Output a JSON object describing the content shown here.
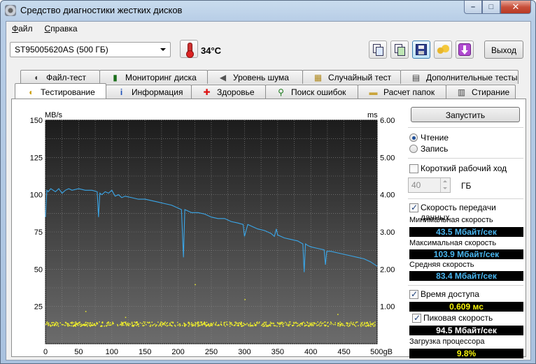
{
  "window": {
    "title": "Средство диагностики жестких дисков",
    "caption_minimize": "–",
    "caption_maximize": "□",
    "caption_close": "✕"
  },
  "menu": [
    {
      "accel": "Ф",
      "rest": "айл"
    },
    {
      "accel": "С",
      "rest": "правка"
    }
  ],
  "toolbar": {
    "drive": "ST95005620AS (500 ГБ)",
    "temperature": "34°C",
    "exit_label": "Выход"
  },
  "tabs_top": [
    "Файл-тест",
    "Мониторинг диска",
    "Уровень шума",
    "Случайный тест",
    "Дополнительные тесты"
  ],
  "tabs_bottom": [
    "Тестирование",
    "Информация",
    "Здоровье",
    "Поиск ошибок",
    "Расчет папок",
    "Стирание"
  ],
  "active_tab": "Тестирование",
  "chart_data": {
    "type": "line",
    "y_left_label": "MB/s",
    "y_right_label": "ms",
    "y_left_ticks": [
      "150",
      "125",
      "100",
      "75",
      "50",
      "25"
    ],
    "y_right_ticks": [
      "6.00",
      "5.00",
      "4.00",
      "3.00",
      "2.00",
      "1.00"
    ],
    "x_ticks": [
      "0",
      "50",
      "100",
      "150",
      "200",
      "250",
      "300",
      "350",
      "400",
      "450",
      "500gB"
    ],
    "x_range": [
      0,
      500
    ],
    "y_left_range": [
      0,
      150
    ],
    "y_right_range": [
      0,
      6
    ],
    "series": [
      {
        "color": "#3aa6e8",
        "x": [
          0,
          2,
          4,
          8,
          15,
          20,
          25,
          30,
          35,
          40,
          50,
          60,
          70,
          78,
          80,
          82,
          85,
          90,
          95,
          100,
          105,
          110,
          115,
          120,
          130,
          140,
          150,
          160,
          170,
          180,
          190,
          200,
          205,
          208,
          210,
          215,
          220,
          230,
          240,
          250,
          260,
          270,
          280,
          290,
          298,
          300,
          305,
          310,
          315,
          320,
          330,
          340,
          345,
          348,
          350,
          355,
          360,
          370,
          380,
          388,
          390,
          392,
          395,
          400,
          410,
          420,
          422,
          424,
          430,
          440,
          450,
          460,
          470,
          480,
          490,
          500
        ],
        "y": [
          85,
          103,
          102,
          104,
          102,
          104,
          101,
          103,
          104,
          103,
          104,
          103,
          103,
          102,
          85,
          101,
          100,
          102,
          101,
          103,
          99,
          100,
          98,
          99,
          98,
          97,
          97,
          96,
          95,
          94,
          93,
          91,
          90,
          58,
          90,
          89,
          88,
          88,
          87,
          85,
          84,
          84,
          82,
          81,
          80,
          72,
          80,
          79,
          78,
          77,
          76,
          74,
          72,
          77,
          73,
          72,
          71,
          70,
          69,
          67,
          48,
          67,
          66,
          65,
          64,
          63,
          53,
          62,
          62,
          61,
          60,
          59,
          58,
          57,
          55,
          52
        ]
      },
      {
        "color": "#f0ef2a",
        "kind": "scatter",
        "band": [
          12,
          15
        ]
      }
    ]
  },
  "side": {
    "run_label": "Запустить",
    "read_label": "Чтение",
    "write_label": "Запись",
    "short_stroke_label": "Короткий рабочий ход",
    "short_stroke_value": "40",
    "short_stroke_unit": "ГБ",
    "transfer_rate_label": "Скорость передачи данных",
    "min_speed_label": "Минимальная скорость",
    "min_speed_value": "43.5 Мбайт/сек",
    "max_speed_label": "Максимальная скорость",
    "max_speed_value": "103.9 Мбайт/сек",
    "avg_speed_label": "Средняя скорость",
    "avg_speed_value": "83.4 Мбайт/сек",
    "access_time_label": "Время доступа",
    "access_time_value": "0.609 мс",
    "burst_rate_label": "Пиковая скорость",
    "burst_rate_value": "94.5 Мбайт/сек",
    "cpu_label": "Загрузка процессора",
    "cpu_value": "9.8%"
  }
}
